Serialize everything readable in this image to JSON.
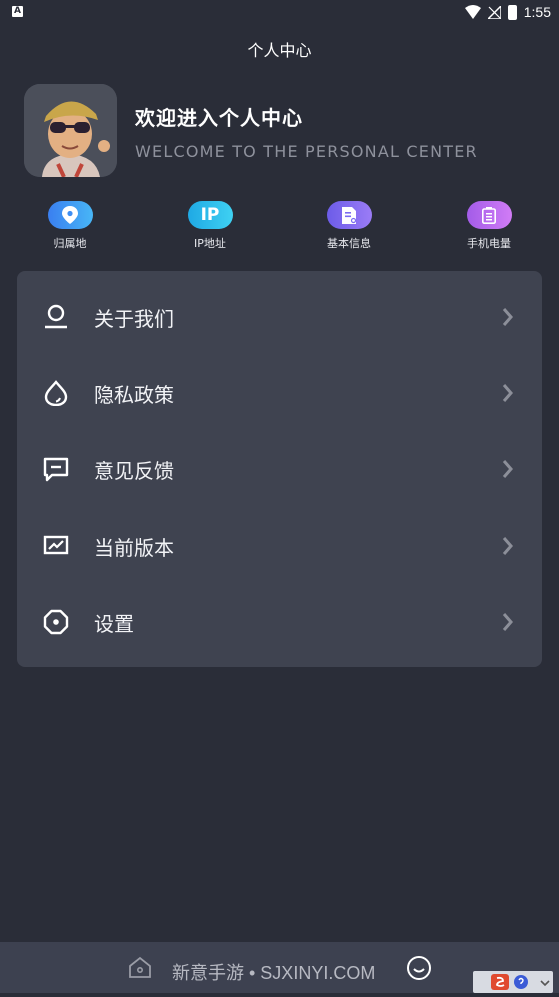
{
  "status_bar": {
    "app_icon": "A",
    "time": "1:55"
  },
  "header": {
    "title": "个人中心"
  },
  "profile": {
    "welcome": "欢迎进入个人中心",
    "welcome_en": "WELCOME TO THE PERSONAL CENTER"
  },
  "quick_actions": [
    {
      "label": "归属地",
      "icon": "location-pin-icon",
      "color": "#3b9af0"
    },
    {
      "label": "IP地址",
      "pill_text": "IP",
      "icon": "ip-icon",
      "color": "#27b6e8"
    },
    {
      "label": "基本信息",
      "icon": "document-icon",
      "color": "#7a6cf0"
    },
    {
      "label": "手机电量",
      "icon": "battery-icon",
      "color": "#b266ee"
    }
  ],
  "menu": [
    {
      "label": "关于我们",
      "icon": "person-icon"
    },
    {
      "label": "隐私政策",
      "icon": "drop-icon"
    },
    {
      "label": "意见反馈",
      "icon": "chat-icon"
    },
    {
      "label": "当前版本",
      "icon": "chart-icon"
    },
    {
      "label": "设置",
      "icon": "settings-icon"
    }
  ],
  "bottom_bar": {
    "watermark": "新意手游 • SJXINYI.COM"
  },
  "colors": {
    "background": "#2a2d38",
    "card": "#3f4350",
    "muted_text": "#8e919c"
  }
}
